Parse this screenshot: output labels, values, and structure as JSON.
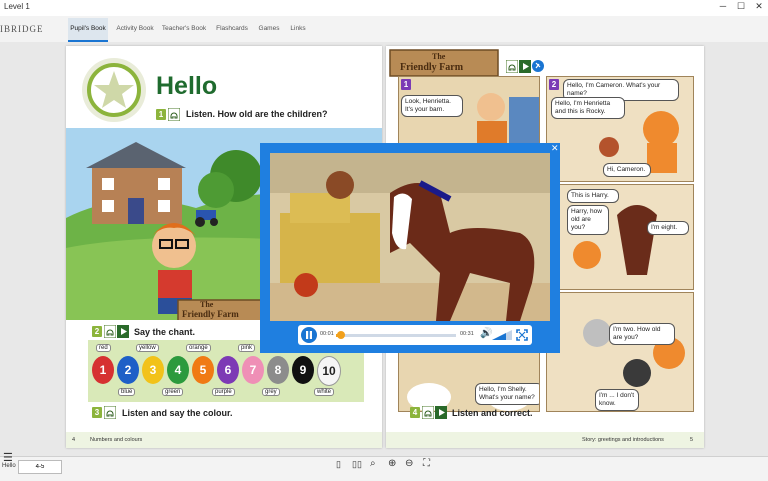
{
  "window": {
    "title": "Level 1"
  },
  "brand": "IBRIDGE",
  "tabs": [
    {
      "label": "Pupil's Book",
      "active": true
    },
    {
      "label": "Activity Book"
    },
    {
      "label": "Teacher's Book"
    },
    {
      "label": "Flashcards"
    },
    {
      "label": "Games"
    },
    {
      "label": "Links"
    }
  ],
  "left_page": {
    "heading": "Hello",
    "activity1": {
      "number": "1",
      "text": "Listen. How old are the children?"
    },
    "sign_text_line1": "The",
    "sign_text_line2": "Friendly Farm",
    "activity2": {
      "number": "2",
      "text": "Say the chant."
    },
    "activity3": {
      "number": "3",
      "text": "Listen and say the colour."
    },
    "colours_top": [
      "red",
      "yellow",
      "orange",
      "pink"
    ],
    "colours_bottom": [
      "blue",
      "green",
      "purple",
      "grey",
      "white"
    ],
    "balloons": [
      {
        "n": "1",
        "color": "#d63131"
      },
      {
        "n": "2",
        "color": "#1e5fc7"
      },
      {
        "n": "3",
        "color": "#f2c21a"
      },
      {
        "n": "4",
        "color": "#2c9a3d"
      },
      {
        "n": "5",
        "color": "#f07a14"
      },
      {
        "n": "6",
        "color": "#7d3ab5"
      },
      {
        "n": "7",
        "color": "#ef8fb6"
      },
      {
        "n": "8",
        "color": "#8c8c8c"
      },
      {
        "n": "9",
        "color": "#111111"
      },
      {
        "n": "10",
        "color": "#f5f5f5"
      }
    ],
    "footer": {
      "page": "4",
      "text": "Numbers and colours"
    }
  },
  "right_page": {
    "logo_line1": "The",
    "logo_line2": "Friendly Farm",
    "panel1": {
      "number": "1",
      "bubble1": "Look, Henrietta. It's your barn."
    },
    "panel2": {
      "number": "2",
      "bubble1": "Hello, I'm Cameron. What's your name?",
      "bubble2": "Hello, I'm Henrietta and this is Rocky.",
      "bubble3": "Hi, Cameron."
    },
    "panel4": {
      "bubble1": "This is Harry.",
      "bubble2": "Harry, how old are you?",
      "bubble3": "I'm eight."
    },
    "panel6": {
      "bubble1": "I'm two. How old are you?",
      "bubble2": "I'm ... I don't know."
    },
    "panel5": {
      "bubble1": "Hello, I'm Shelly. What's your name?"
    },
    "activity4": {
      "number": "4",
      "text": "Listen and correct."
    },
    "footer": {
      "page": "5",
      "text": "Story: greetings and introductions"
    }
  },
  "video": {
    "time_current": "00:01",
    "time_total": "00:31",
    "progress": 0.02
  },
  "bottom": {
    "menu_label": "Hello",
    "page_field": "4-5"
  },
  "colors": {
    "accent": "#1a75d2",
    "green_heading": "#1f6b2e",
    "badge": "#8cb43c"
  }
}
